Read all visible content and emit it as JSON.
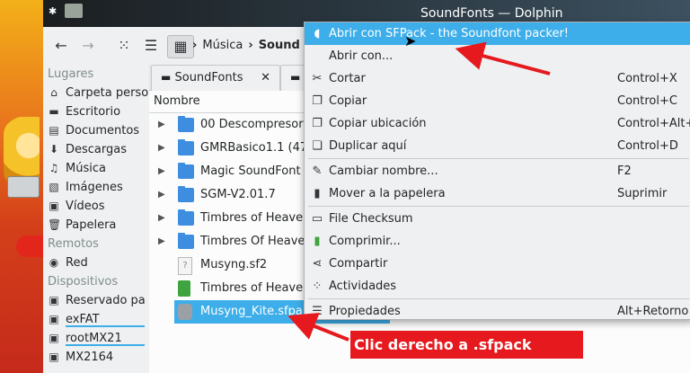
{
  "window": {
    "title": "SoundFonts — Dolphin"
  },
  "toolbar": {
    "back_icon": "back-arrow-icon",
    "forward_icon": "forward-arrow-icon",
    "view_icons": [
      "icons-view-icon",
      "list-view-icon",
      "detailed-view-icon"
    ],
    "breadcrumb": [
      "Música",
      "Sound"
    ]
  },
  "places": {
    "sections": {
      "lugares": "Lugares",
      "remotos": "Remotos",
      "dispositivos": "Dispositivos"
    },
    "lugares": [
      {
        "label": "Carpeta perso",
        "icon": "home-icon"
      },
      {
        "label": "Escritorio",
        "icon": "desktop-icon"
      },
      {
        "label": "Documentos",
        "icon": "documents-icon"
      },
      {
        "label": "Descargas",
        "icon": "downloads-icon"
      },
      {
        "label": "Música",
        "icon": "music-icon"
      },
      {
        "label": "Imágenes",
        "icon": "pictures-icon"
      },
      {
        "label": "Vídeos",
        "icon": "videos-icon"
      },
      {
        "label": "Papelera",
        "icon": "trash-icon"
      }
    ],
    "remotos": [
      {
        "label": "Red",
        "icon": "network-icon"
      }
    ],
    "dispositivos": [
      {
        "label": "Reservado pa",
        "icon": "drive-icon"
      },
      {
        "label": "exFAT",
        "icon": "drive-icon"
      },
      {
        "label": "rootMX21",
        "icon": "drive-icon"
      },
      {
        "label": "MX2164",
        "icon": "drive-icon"
      }
    ]
  },
  "tabs": [
    {
      "label": "SoundFonts"
    },
    {
      "label": ""
    }
  ],
  "files": {
    "column_name": "Nombre",
    "rows": [
      {
        "name": "00 Descompresor",
        "type": "folder",
        "expandable": true
      },
      {
        "name": "GMRBasico1.1 (47",
        "type": "folder",
        "expandable": true
      },
      {
        "name": "Magic SoundFont",
        "type": "folder",
        "expandable": true
      },
      {
        "name": "SGM-V2.01.7",
        "type": "folder",
        "expandable": true
      },
      {
        "name": "Timbres of Heave",
        "type": "folder",
        "expandable": true
      },
      {
        "name": "Timbres Of Heave",
        "type": "folder",
        "expandable": true
      },
      {
        "name": "Musyng.sf2",
        "type": "unknown",
        "expandable": false
      },
      {
        "name": "Timbres of Heave",
        "type": "archive",
        "expandable": false
      },
      {
        "name": "Musyng_Kite.sfpa",
        "type": "sfpack",
        "expandable": false,
        "selected": true
      }
    ]
  },
  "context_menu": {
    "items": [
      {
        "label": "Abrir con SFPack - the Soundfont packer!",
        "shortcut": "",
        "icon": "sfpack-icon",
        "highlighted": true
      },
      {
        "label": "Abrir con...",
        "shortcut": "",
        "icon": ""
      },
      {
        "label": "Cortar",
        "shortcut": "Control+X",
        "icon": "scissors-icon"
      },
      {
        "label": "Copiar",
        "shortcut": "Control+C",
        "icon": "copy-icon"
      },
      {
        "label": "Copiar ubicación",
        "shortcut": "Control+Alt+",
        "icon": "copy-location-icon"
      },
      {
        "label": "Duplicar aquí",
        "shortcut": "Control+D",
        "icon": "duplicate-icon",
        "separator_after": true
      },
      {
        "label": "Cambiar nombre...",
        "shortcut": "F2",
        "icon": "rename-icon"
      },
      {
        "label": "Mover a la papelera",
        "shortcut": "Suprimir",
        "icon": "trash-icon",
        "separator_after": true
      },
      {
        "label": "File Checksum",
        "shortcut": "",
        "icon": "terminal-icon"
      },
      {
        "label": "Comprimir...",
        "shortcut": "",
        "icon": "compress-icon"
      },
      {
        "label": "Compartir",
        "shortcut": "",
        "icon": "share-icon"
      },
      {
        "label": "Actividades",
        "shortcut": "",
        "icon": "activities-icon",
        "separator_after": true
      },
      {
        "label": "Propiedades",
        "shortcut": "Alt+Retorno",
        "icon": "properties-icon"
      }
    ]
  },
  "annotation": {
    "text": "Clic derecho a .sfpack",
    "color": "#e5191e"
  },
  "colors": {
    "accent": "#3daee9",
    "folder": "#3d8ee0",
    "arrow": "#e5191e"
  }
}
